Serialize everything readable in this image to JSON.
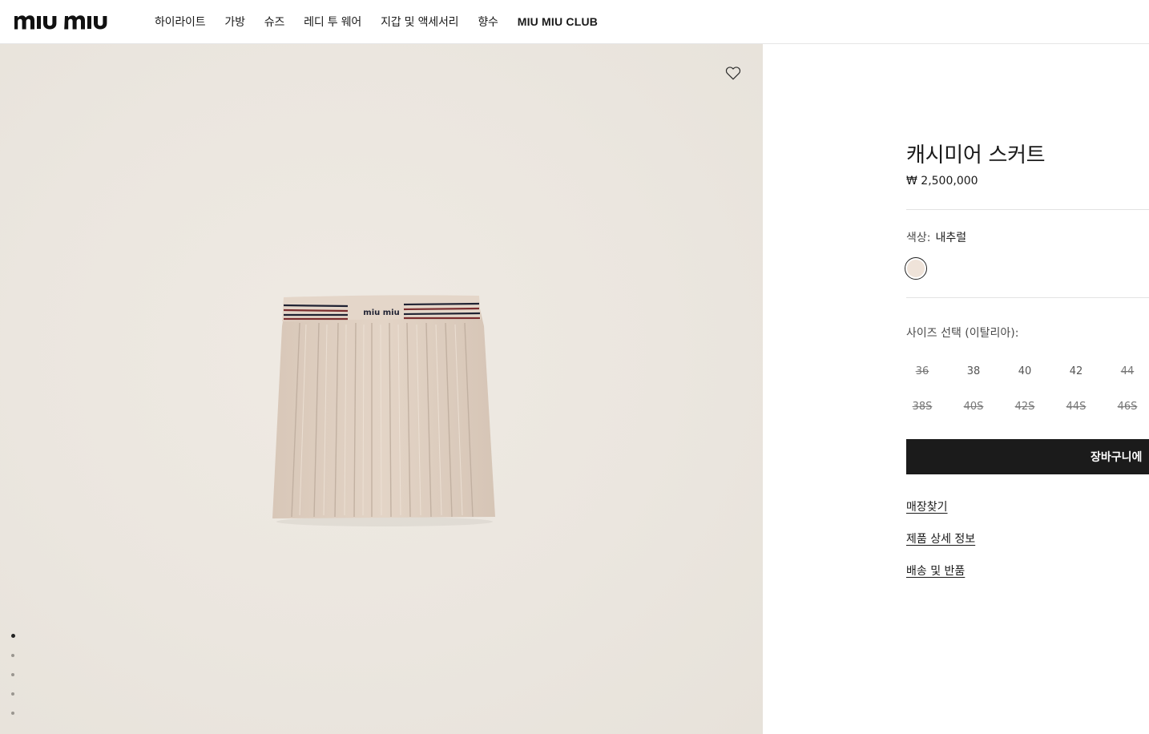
{
  "brand": {
    "logo_text": "miu miu"
  },
  "nav": {
    "items": [
      "하이라이트",
      "가방",
      "슈즈",
      "레디 투 웨어",
      "지갑 및 액세서리",
      "향수",
      "MIU MIU CLUB"
    ]
  },
  "gallery": {
    "wishlist_icon": "heart-outline-icon",
    "slides_total": 5,
    "active_slide": 1,
    "waistband_logo": "miu miu"
  },
  "product": {
    "title": "캐시미어 스커트",
    "price": "₩ 2,500,000",
    "color_label": "색상:",
    "color_value": "내추럴",
    "swatch_color": "#efe3d9",
    "size_label": "사이즈 선택 (이탈리아):",
    "sizes_row1": [
      {
        "label": "36",
        "available": false
      },
      {
        "label": "38",
        "available": true
      },
      {
        "label": "40",
        "available": true
      },
      {
        "label": "42",
        "available": true
      },
      {
        "label": "44",
        "available": false
      }
    ],
    "sizes_row2": [
      {
        "label": "38S",
        "available": false
      },
      {
        "label": "40S",
        "available": false
      },
      {
        "label": "42S",
        "available": false
      },
      {
        "label": "44S",
        "available": false
      },
      {
        "label": "46S",
        "available": false
      }
    ],
    "cart_button": "장바구니에",
    "links": [
      "매장찾기",
      "제품 상세 정보",
      "배송 및 반품"
    ]
  }
}
